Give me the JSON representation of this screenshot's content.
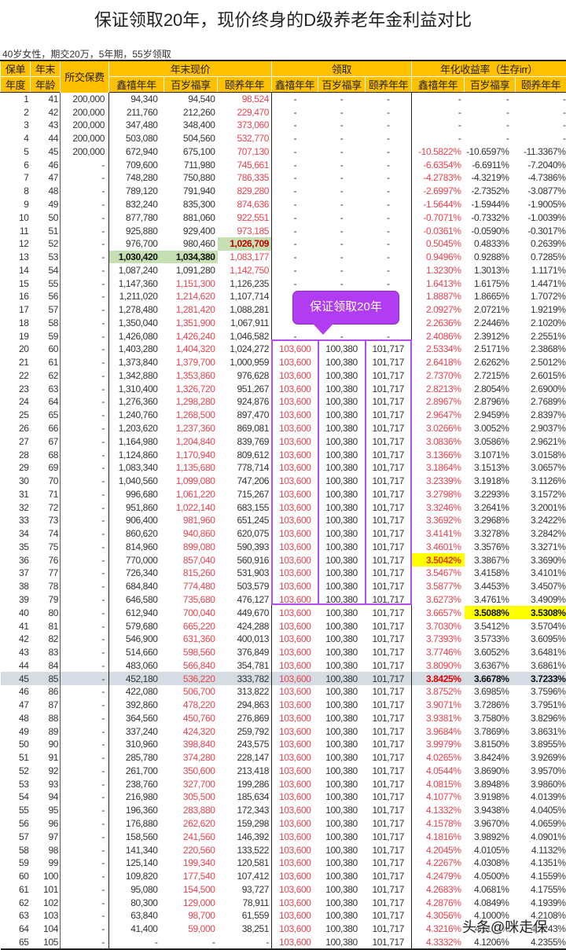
{
  "title": "保证领取20年，现价终身的D级养老年金利益对比",
  "subtitle": "40岁女性，期交20万，5年期，55岁领取",
  "callout": "保证领取20年",
  "watermark": "头条@咪走保",
  "colors": {
    "header": "#ffc000",
    "red": "#e8434f",
    "purple": "#b44cf0",
    "green": "#c6e0b4",
    "yellow": "#ffff00"
  },
  "header": {
    "year": [
      "保单",
      "年度"
    ],
    "age": [
      "年末",
      "年龄"
    ],
    "premium": "所交保费",
    "cv_group": "年末现价",
    "payout_group": "领取",
    "irr_group": "年化收益率（生存irr）",
    "products": [
      "鑫禧年年",
      "百岁福享",
      "颐养年年"
    ]
  },
  "rows": [
    [
      "1",
      "41",
      "200,000",
      "94,340",
      "94,540",
      "98,524",
      "-",
      "-",
      "-",
      "-",
      "-",
      "-"
    ],
    [
      "2",
      "42",
      "200,000",
      "211,760",
      "212,260",
      "229,470",
      "-",
      "-",
      "-",
      "-",
      "-",
      "-"
    ],
    [
      "3",
      "43",
      "200,000",
      "347,480",
      "348,400",
      "373,060",
      "-",
      "-",
      "-",
      "-",
      "-",
      "-"
    ],
    [
      "4",
      "44",
      "200,000",
      "503,080",
      "504,560",
      "532,770",
      "-",
      "-",
      "-",
      "-",
      "-",
      "-"
    ],
    [
      "5",
      "45",
      "200,000",
      "672,940",
      "675,100",
      "707,130",
      "-",
      "-",
      "-",
      "-10.5822%",
      "-10.6597%",
      "-11.3367%"
    ],
    [
      "6",
      "46",
      "-",
      "709,600",
      "711,980",
      "745,661",
      "-",
      "-",
      "-",
      "-6.6354%",
      "-6.6911%",
      "-7.2040%"
    ],
    [
      "7",
      "47",
      "-",
      "748,280",
      "750,880",
      "786,335",
      "-",
      "-",
      "-",
      "-4.2783%",
      "-4.3219%",
      "-4.7386%"
    ],
    [
      "8",
      "48",
      "-",
      "789,120",
      "791,940",
      "829,280",
      "-",
      "-",
      "-",
      "-2.6997%",
      "-2.7352%",
      "-3.0877%"
    ],
    [
      "9",
      "49",
      "-",
      "832,240",
      "835,300",
      "874,636",
      "-",
      "-",
      "-",
      "-1.5644%",
      "-1.5944%",
      "-1.9005%"
    ],
    [
      "10",
      "50",
      "-",
      "877,780",
      "881,060",
      "922,551",
      "-",
      "-",
      "-",
      "-0.7071%",
      "-0.7332%",
      "-1.0039%"
    ],
    [
      "11",
      "51",
      "-",
      "925,880",
      "929,400",
      "973,185",
      "-",
      "-",
      "-",
      "-0.0361%",
      "-0.0590%",
      "-0.3017%"
    ],
    [
      "12",
      "52",
      "-",
      "976,700",
      "980,460",
      "1,026,709",
      "-",
      "-",
      "-",
      "0.5045%",
      "0.4833%",
      "0.2639%"
    ],
    [
      "13",
      "53",
      "-",
      "1,030,420",
      "1,034,380",
      "1,083,177",
      "-",
      "-",
      "-",
      "0.9496%",
      "0.9288%",
      "0.7285%"
    ],
    [
      "14",
      "54",
      "-",
      "1,087,240",
      "1,091,280",
      "1,142,750",
      "-",
      "-",
      "-",
      "1.3230%",
      "1.3013%",
      "1.1171%"
    ],
    [
      "15",
      "55",
      "-",
      "1,147,360",
      "1,151,300",
      "1,126,235",
      "-",
      "-",
      "-",
      "1.6413%",
      "1.6175%",
      "1.4471%"
    ],
    [
      "16",
      "56",
      "-",
      "1,211,020",
      "1,214,620",
      "1,107,714",
      "",
      "",
      "",
      "1.8887%",
      "1.8665%",
      "1.7072%"
    ],
    [
      "17",
      "57",
      "-",
      "1,278,480",
      "1,281,420",
      "1,088,281",
      "",
      "",
      "",
      "2.0927%",
      "2.0721%",
      "1.9219%"
    ],
    [
      "18",
      "58",
      "-",
      "1,350,040",
      "1,351,900",
      "1,067,911",
      "",
      "",
      "",
      "2.2636%",
      "2.2446%",
      "2.1020%"
    ],
    [
      "19",
      "59",
      "-",
      "1,426,080",
      "1,426,240",
      "1,046,582",
      "-",
      "-",
      "-",
      "2.4086%",
      "2.3912%",
      "2.2551%"
    ],
    [
      "20",
      "60",
      "-",
      "1,403,280",
      "1,404,320",
      "1,024,272",
      "103,600",
      "100,380",
      "101,717",
      "2.5334%",
      "2.5171%",
      "2.3868%"
    ],
    [
      "21",
      "61",
      "-",
      "1,373,840",
      "1,379,700",
      "1,000,959",
      "103,600",
      "100,380",
      "101,717",
      "2.6418%",
      "2.6262%",
      "2.5012%"
    ],
    [
      "22",
      "62",
      "-",
      "1,342,880",
      "1,353,860",
      "976,628",
      "103,600",
      "100,380",
      "101,717",
      "2.7370%",
      "2.7215%",
      "2.6015%"
    ],
    [
      "23",
      "63",
      "-",
      "1,310,400",
      "1,326,720",
      "951,267",
      "103,600",
      "100,380",
      "101,717",
      "2.8213%",
      "2.8054%",
      "2.6900%"
    ],
    [
      "24",
      "64",
      "-",
      "1,276,360",
      "1,298,280",
      "924,876",
      "103,600",
      "100,380",
      "101,717",
      "2.8967%",
      "2.8796%",
      "2.7689%"
    ],
    [
      "25",
      "65",
      "-",
      "1,240,760",
      "1,268,500",
      "897,470",
      "103,600",
      "100,380",
      "101,717",
      "2.9647%",
      "2.9459%",
      "2.8397%"
    ],
    [
      "26",
      "66",
      "-",
      "1,203,620",
      "1,237,360",
      "869,081",
      "103,600",
      "100,380",
      "101,717",
      "3.0266%",
      "3.0052%",
      "2.9037%"
    ],
    [
      "27",
      "67",
      "-",
      "1,164,980",
      "1,204,840",
      "839,769",
      "103,600",
      "100,380",
      "101,717",
      "3.0836%",
      "3.0586%",
      "2.9621%"
    ],
    [
      "28",
      "68",
      "-",
      "1,124,860",
      "1,170,940",
      "809,612",
      "103,600",
      "100,380",
      "101,717",
      "3.1366%",
      "3.1071%",
      "3.0158%"
    ],
    [
      "29",
      "69",
      "-",
      "1,083,340",
      "1,135,680",
      "778,714",
      "103,600",
      "100,380",
      "101,717",
      "3.1864%",
      "3.1513%",
      "3.0657%"
    ],
    [
      "30",
      "70",
      "-",
      "1,040,560",
      "1,099,080",
      "747,206",
      "103,600",
      "100,380",
      "101,717",
      "3.2339%",
      "3.1918%",
      "3.1126%"
    ],
    [
      "31",
      "71",
      "-",
      "996,680",
      "1,061,220",
      "715,267",
      "103,600",
      "100,380",
      "101,717",
      "3.2798%",
      "3.2293%",
      "3.1572%"
    ],
    [
      "32",
      "72",
      "-",
      "951,860",
      "1,022,140",
      "683,155",
      "103,600",
      "100,380",
      "101,717",
      "3.3246%",
      "3.2641%",
      "3.2001%"
    ],
    [
      "33",
      "73",
      "-",
      "906,400",
      "981,960",
      "651,245",
      "103,600",
      "100,380",
      "101,717",
      "3.3692%",
      "3.2968%",
      "3.2422%"
    ],
    [
      "34",
      "74",
      "-",
      "860,620",
      "940,860",
      "620,075",
      "103,600",
      "100,380",
      "101,717",
      "3.4141%",
      "3.3278%",
      "3.2842%"
    ],
    [
      "35",
      "75",
      "-",
      "814,960",
      "899,080",
      "590,393",
      "103,600",
      "100,380",
      "101,717",
      "3.4601%",
      "3.3576%",
      "3.3271%"
    ],
    [
      "36",
      "76",
      "-",
      "770,000",
      "857,040",
      "560,916",
      "103,600",
      "100,380",
      "101,717",
      "3.5042%",
      "3.3867%",
      "3.3690%"
    ],
    [
      "37",
      "77",
      "-",
      "726,340",
      "815,260",
      "531,903",
      "103,600",
      "100,380",
      "101,717",
      "3.5467%",
      "3.4158%",
      "3.4101%"
    ],
    [
      "38",
      "78",
      "-",
      "684,840",
      "774,480",
      "503,579",
      "103,600",
      "100,380",
      "101,717",
      "3.5877%",
      "3.4453%",
      "3.4507%"
    ],
    [
      "39",
      "79",
      "-",
      "646,580",
      "735,680",
      "476,127",
      "103,600",
      "100,380",
      "101,717",
      "3.6273%",
      "3.4761%",
      "3.4909%"
    ],
    [
      "40",
      "80",
      "-",
      "612,940",
      "700,040",
      "449,670",
      "103,600",
      "100,380",
      "101,717",
      "3.6657%",
      "3.5088%",
      "3.5308%"
    ],
    [
      "41",
      "81",
      "-",
      "579,680",
      "665,220",
      "424,288",
      "103,600",
      "100,380",
      "101,717",
      "3.7030%",
      "3.5412%",
      "3.5704%"
    ],
    [
      "42",
      "82",
      "-",
      "546,900",
      "631,360",
      "400,013",
      "103,600",
      "100,380",
      "101,717",
      "3.7393%",
      "3.5733%",
      "3.6095%"
    ],
    [
      "43",
      "83",
      "-",
      "514,660",
      "598,560",
      "376,849",
      "103,600",
      "100,380",
      "101,717",
      "3.7746%",
      "3.6052%",
      "3.6481%"
    ],
    [
      "44",
      "84",
      "-",
      "483,060",
      "566,840",
      "354,781",
      "103,600",
      "100,380",
      "101,717",
      "3.8090%",
      "3.6367%",
      "3.6861%"
    ],
    [
      "45",
      "85",
      "-",
      "452,180",
      "536,220",
      "333,782",
      "103,600",
      "100,380",
      "101,717",
      "3.8425%",
      "3.6678%",
      "3.7233%"
    ],
    [
      "46",
      "86",
      "-",
      "422,080",
      "506,700",
      "313,822",
      "103,600",
      "100,380",
      "101,717",
      "3.8752%",
      "3.6985%",
      "3.7596%"
    ],
    [
      "47",
      "87",
      "-",
      "392,860",
      "478,220",
      "294,863",
      "103,600",
      "100,380",
      "101,717",
      "3.9071%",
      "3.7286%",
      "3.7951%"
    ],
    [
      "48",
      "88",
      "-",
      "364,560",
      "450,760",
      "276,869",
      "103,600",
      "100,380",
      "101,717",
      "3.9381%",
      "3.7580%",
      "3.8296%"
    ],
    [
      "49",
      "89",
      "-",
      "337,240",
      "424,320",
      "259,792",
      "103,600",
      "100,380",
      "101,717",
      "3.9684%",
      "3.7869%",
      "3.8631%"
    ],
    [
      "50",
      "90",
      "-",
      "310,960",
      "398,840",
      "243,575",
      "103,600",
      "100,380",
      "101,717",
      "3.9979%",
      "3.8150%",
      "3.8955%"
    ],
    [
      "51",
      "91",
      "-",
      "285,780",
      "374,280",
      "228,147",
      "103,600",
      "100,380",
      "101,717",
      "4.0265%",
      "3.8424%",
      "3.9269%"
    ],
    [
      "52",
      "92",
      "-",
      "261,700",
      "350,600",
      "213,418",
      "103,600",
      "100,380",
      "101,717",
      "4.0544%",
      "3.8690%",
      "3.9570%"
    ],
    [
      "53",
      "93",
      "-",
      "238,760",
      "327,700",
      "199,286",
      "103,600",
      "100,380",
      "101,717",
      "4.0815%",
      "3.8948%",
      "3.9860%"
    ],
    [
      "54",
      "94",
      "-",
      "216,980",
      "305,500",
      "185,634",
      "103,600",
      "100,380",
      "101,717",
      "4.1077%",
      "3.9198%",
      "4.0139%"
    ],
    [
      "55",
      "95",
      "-",
      "196,360",
      "283,880",
      "172,343",
      "103,600",
      "100,380",
      "101,717",
      "4.1332%",
      "3.9438%",
      "4.0405%"
    ],
    [
      "56",
      "96",
      "-",
      "176,880",
      "262,620",
      "159,298",
      "103,600",
      "100,380",
      "101,717",
      "4.1578%",
      "3.9670%",
      "4.0659%"
    ],
    [
      "57",
      "97",
      "-",
      "158,560",
      "241,560",
      "146,392",
      "103,600",
      "100,380",
      "101,717",
      "4.1816%",
      "3.9892%",
      "4.0901%"
    ],
    [
      "58",
      "98",
      "-",
      "141,340",
      "220,560",
      "133,522",
      "103,600",
      "100,380",
      "101,717",
      "4.2045%",
      "4.0105%",
      "4.1132%"
    ],
    [
      "59",
      "99",
      "-",
      "125,140",
      "199,340",
      "120,581",
      "103,600",
      "100,380",
      "101,717",
      "4.2267%",
      "4.0308%",
      "4.1351%"
    ],
    [
      "60",
      "100",
      "-",
      "109,820",
      "177,540",
      "107,412",
      "103,600",
      "100,380",
      "101,717",
      "4.2479%",
      "4.0500%",
      "4.1559%"
    ],
    [
      "61",
      "101",
      "-",
      "95,080",
      "154,500",
      "93,727",
      "103,600",
      "100,380",
      "101,717",
      "4.2683%",
      "4.0681%",
      "4.1755%"
    ],
    [
      "62",
      "102",
      "-",
      "80,300",
      "129,000",
      "78,911",
      "103,600",
      "100,380",
      "101,717",
      "4.2876%",
      "4.0849%",
      "4.1939%"
    ],
    [
      "63",
      "103",
      "-",
      "63,840",
      "98,700",
      "61,559",
      "103,600",
      "100,380",
      "101,717",
      "4.3056%",
      "4.1000%",
      "4.2108%"
    ],
    [
      "64",
      "104",
      "-",
      "41,400",
      "59,000",
      "38,251",
      "103,600",
      "100,380",
      "101,717",
      "4.3216%",
      "4.1103%",
      "4.2243%"
    ],
    [
      "65",
      "105",
      "-",
      "-",
      "-",
      "-",
      "103,600",
      "100,380",
      "101,717",
      "4.3332%",
      "4.1206%",
      "4.2355%"
    ]
  ]
}
